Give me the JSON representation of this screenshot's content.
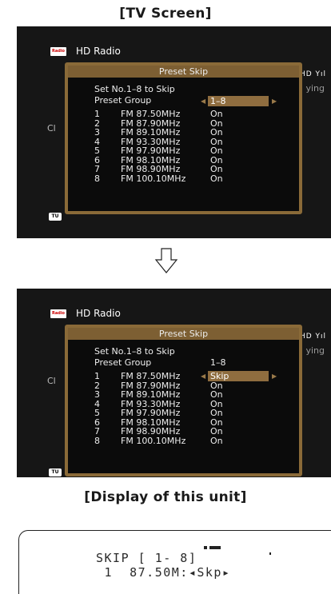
{
  "headings": {
    "tv": "[TV Screen]",
    "display": "[Display of this unit]"
  },
  "header": {
    "logo": "Radio",
    "title": "HD Radio",
    "icons": "HD Yıl",
    "right_text": "ying",
    "left_text": "Cl",
    "tu": "TU"
  },
  "dialog": {
    "title": "Preset Skip",
    "set_label": "Set No.1–8 to Skip",
    "group_label": "Preset Group",
    "group_value": "1–8",
    "presets": [
      {
        "no": "1",
        "freq": "FM 87.50MHz"
      },
      {
        "no": "2",
        "freq": "FM 87.90MHz"
      },
      {
        "no": "3",
        "freq": "FM 89.10MHz"
      },
      {
        "no": "4",
        "freq": "FM 93.30MHz"
      },
      {
        "no": "5",
        "freq": "FM 97.90MHz"
      },
      {
        "no": "6",
        "freq": "FM 98.10MHz"
      },
      {
        "no": "7",
        "freq": "FM 98.90MHz"
      },
      {
        "no": "8",
        "freq": "FM 100.10MHz"
      }
    ],
    "status_before": [
      "On",
      "On",
      "On",
      "On",
      "On",
      "On",
      "On",
      "On"
    ],
    "status_after": [
      "Skip",
      "On",
      "On",
      "On",
      "On",
      "On",
      "On",
      "On"
    ]
  },
  "lcd": {
    "line1": "SKIP [ 1- 8]",
    "line2": " 1  87.50M:◂Skp▸"
  },
  "colors": {
    "accent": "#8f6d3f",
    "tv_bg": "#161616"
  }
}
